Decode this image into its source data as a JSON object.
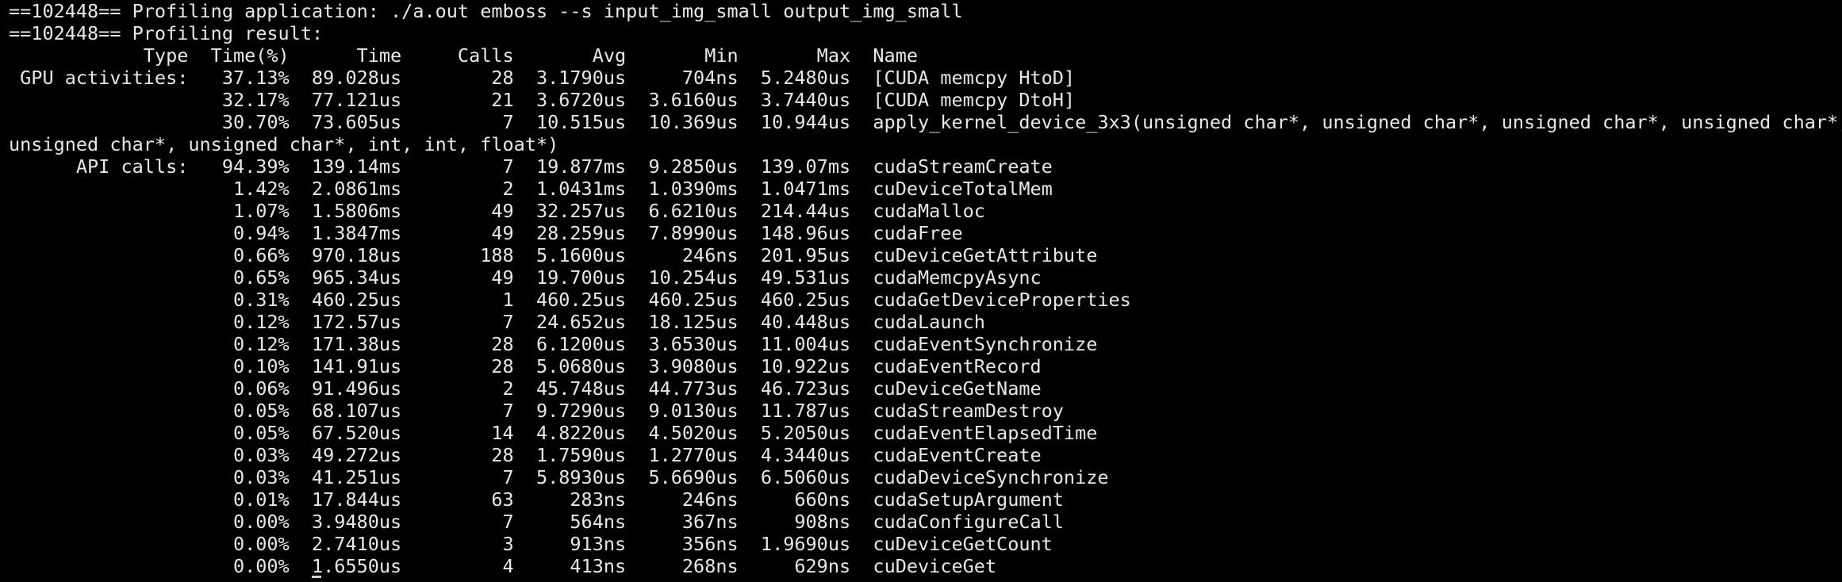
{
  "terminal": {
    "lines": [
      "==102448== Profiling application: ./a.out emboss --s input_img_small output_img_small",
      "==102448== Profiling result:",
      "            Type  Time(%)      Time     Calls       Avg       Min       Max  Name",
      " GPU activities:   37.13%  89.028us        28  3.1790us     704ns  5.2480us  [CUDA memcpy HtoD]",
      "                   32.17%  77.121us        21  3.6720us  3.6160us  3.7440us  [CUDA memcpy DtoH]",
      "                   30.70%  73.605us         7  10.515us  10.369us  10.944us  apply_kernel_device_3x3(unsigned char*, unsigned char*, unsigned char*, unsigned char*,",
      "unsigned char*, unsigned char*, int, int, float*)",
      "      API calls:   94.39%  139.14ms         7  19.877ms  9.2850us  139.07ms  cudaStreamCreate",
      "                    1.42%  2.0861ms         2  1.0431ms  1.0390ms  1.0471ms  cuDeviceTotalMem",
      "                    1.07%  1.5806ms        49  32.257us  6.6210us  214.44us  cudaMalloc",
      "                    0.94%  1.3847ms        49  28.259us  7.8990us  148.96us  cudaFree",
      "                    0.66%  970.18us       188  5.1600us     246ns  201.95us  cuDeviceGetAttribute",
      "                    0.65%  965.34us        49  19.700us  10.254us  49.531us  cudaMemcpyAsync",
      "                    0.31%  460.25us         1  460.25us  460.25us  460.25us  cudaGetDeviceProperties",
      "                    0.12%  172.57us         7  24.652us  18.125us  40.448us  cudaLaunch",
      "                    0.12%  171.38us        28  6.1200us  3.6530us  11.004us  cudaEventSynchronize",
      "                    0.10%  141.91us        28  5.0680us  3.9080us  10.922us  cudaEventRecord",
      "                    0.06%  91.496us         2  45.748us  44.773us  46.723us  cuDeviceGetName",
      "                    0.05%  68.107us         7  9.7290us  9.0130us  11.787us  cudaStreamDestroy",
      "                    0.05%  67.520us        14  4.8220us  4.5020us  5.2050us  cudaEventElapsedTime",
      "                    0.03%  49.272us        28  1.7590us  1.2770us  4.3440us  cudaEventCreate",
      "                    0.03%  41.251us         7  5.8930us  5.6690us  6.5060us  cudaDeviceSynchronize",
      "                    0.01%  17.844us        63     283ns     246ns     660ns  cudaSetupArgument",
      "                    0.00%  3.9480us         7     564ns     367ns     908ns  cudaConfigureCall",
      "                    0.00%  2.7410us         3     913ns     356ns  1.9690us  cuDeviceGetCount"
    ],
    "last_line_before_cursor": "                    0.00%  ",
    "last_line_after_cursor": "1.6550us         4     413ns     268ns     629ns  cuDeviceGet",
    "colors": {
      "background": "#000000",
      "foreground": "#e8e8e8"
    }
  }
}
